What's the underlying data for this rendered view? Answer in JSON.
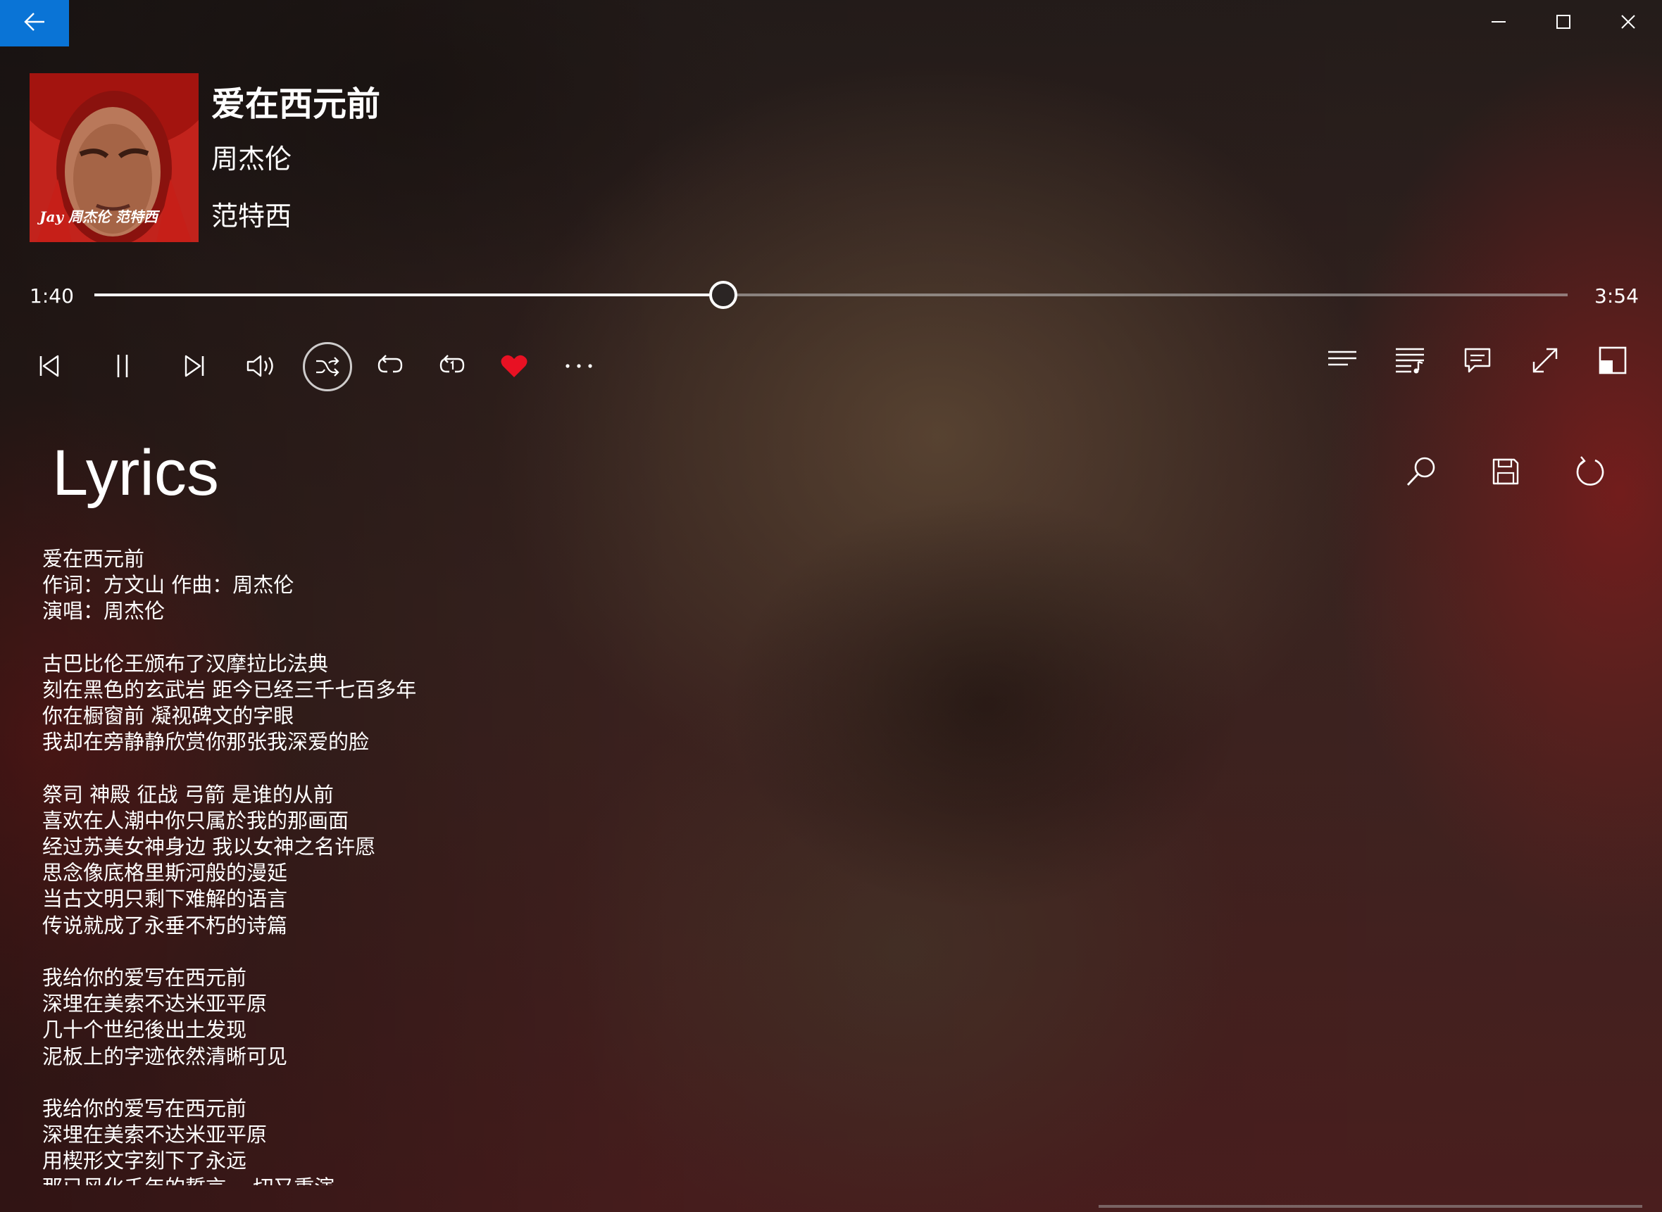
{
  "window": {
    "back_icon": "arrow-left-icon",
    "minimize_icon": "minimize-icon",
    "maximize_icon": "maximize-icon",
    "close_icon": "close-icon",
    "accent_color": "#0a74d6"
  },
  "now_playing": {
    "title": "爱在西元前",
    "artist": "周杰伦",
    "album": "范特西",
    "cover_icon": "album-cover-image",
    "cover_text": "Jay 周杰伦 范特西"
  },
  "progress": {
    "elapsed": "1:40",
    "duration": "3:54",
    "fraction": 0.427
  },
  "controls": {
    "left": [
      {
        "name": "previous-button",
        "icon": "skip-previous-icon"
      },
      {
        "name": "pause-button",
        "icon": "pause-icon"
      },
      {
        "name": "next-button",
        "icon": "skip-next-icon"
      },
      {
        "name": "volume-button",
        "icon": "volume-icon"
      },
      {
        "name": "shuffle-button",
        "icon": "shuffle-icon",
        "active": true
      },
      {
        "name": "repeat-button",
        "icon": "repeat-icon"
      },
      {
        "name": "repeat-one-button",
        "icon": "repeat-one-icon"
      },
      {
        "name": "favorite-button",
        "icon": "heart-icon",
        "color": "#e81123"
      },
      {
        "name": "more-button",
        "icon": "more-icon"
      }
    ],
    "right": [
      {
        "name": "now-playing-list-button",
        "icon": "list-icon"
      },
      {
        "name": "playlist-button",
        "icon": "playlist-icon"
      },
      {
        "name": "lyrics-button",
        "icon": "comment-icon"
      },
      {
        "name": "fullscreen-button",
        "icon": "expand-icon"
      },
      {
        "name": "mini-player-button",
        "icon": "mini-view-icon"
      }
    ]
  },
  "lyrics": {
    "header": "Lyrics",
    "tools": [
      {
        "name": "search-lyrics-button",
        "icon": "search-icon"
      },
      {
        "name": "save-lyrics-button",
        "icon": "save-icon"
      },
      {
        "name": "refresh-lyrics-button",
        "icon": "refresh-icon"
      }
    ],
    "lines": [
      "爱在西元前",
      "作词：方文山 作曲：周杰伦",
      "演唱：周杰伦",
      "",
      "古巴比伦王颁布了汉摩拉比法典",
      "刻在黑色的玄武岩 距今已经三千七百多年",
      "你在橱窗前 凝视碑文的字眼",
      "我却在旁静静欣赏你那张我深爱的脸",
      "",
      "祭司 神殿 征战 弓箭 是谁的从前",
      "喜欢在人潮中你只属於我的那画面",
      "经过苏美女神身边 我以女神之名许愿",
      "思念像底格里斯河般的漫延",
      "当古文明只剩下难解的语言",
      "传说就成了永垂不朽的诗篇",
      "",
      "我给你的爱写在西元前",
      "深埋在美索不达米亚平原",
      "几十个世纪後出土发现",
      "泥板上的字迹依然清晰可见",
      "",
      "我给你的爱写在西元前",
      "深埋在美索不达米亚平原",
      "用楔形文字刻下了永远",
      "那已风化千年的誓言 一切又重演"
    ]
  }
}
